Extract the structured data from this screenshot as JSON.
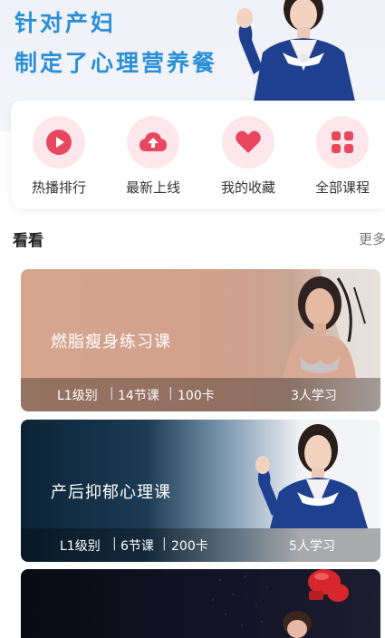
{
  "banner": {
    "line1": "针对产妇",
    "line2": "制定了心理营养餐"
  },
  "quick_entries": [
    {
      "label": "热播排行",
      "icon": "play-icon"
    },
    {
      "label": "最新上线",
      "icon": "upload-icon"
    },
    {
      "label": "我的收藏",
      "icon": "heart-icon"
    },
    {
      "label": "全部课程",
      "icon": "grid-icon"
    }
  ],
  "section": {
    "title": "看看",
    "more": "更多"
  },
  "courses": [
    {
      "title": "燃脂瘦身练习课",
      "level": "L1级别",
      "lessons": "14节课",
      "calories": "100卡",
      "learners": "3人学习"
    },
    {
      "title": "产后抑郁心理课",
      "level": "L1级别",
      "lessons": "6节课",
      "calories": "200卡",
      "learners": "5人学习"
    },
    {
      "title": "",
      "level": "",
      "lessons": "",
      "calories": "",
      "learners": ""
    }
  ],
  "colors": {
    "brand_blue": "#2b8fd8",
    "icon_pink": "#e8485f",
    "icon_bg": "#fde7ec"
  }
}
